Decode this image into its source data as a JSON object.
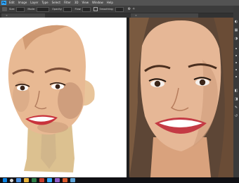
{
  "menubar": {
    "app_icon": "Ps",
    "items": [
      "Edit",
      "Image",
      "Layer",
      "Type",
      "Select",
      "Filter",
      "3D",
      "View",
      "Window",
      "Help"
    ]
  },
  "optionsbar": {
    "tool_icon": "brush-tool-icon",
    "size_label": "Size:",
    "mode_label": "Mode:",
    "opacity_label": "Opacity:",
    "flow_label": "Flow:",
    "smoothing_label": "Smoothing:"
  },
  "tabs": {
    "left_label": "",
    "right_label": ""
  },
  "right_panel": {
    "icons": [
      "color-icon",
      "swatches-icon",
      "adjustments-icon",
      "layers-icon",
      "channels-icon",
      "paths-icon",
      "history-icon"
    ]
  },
  "colors": {
    "photoshop_blue": "#31a8ff",
    "workspace": "#2b2b2b",
    "panel": "#3a3a3a",
    "skin": "#e6b796",
    "lips": "#c8323c"
  }
}
